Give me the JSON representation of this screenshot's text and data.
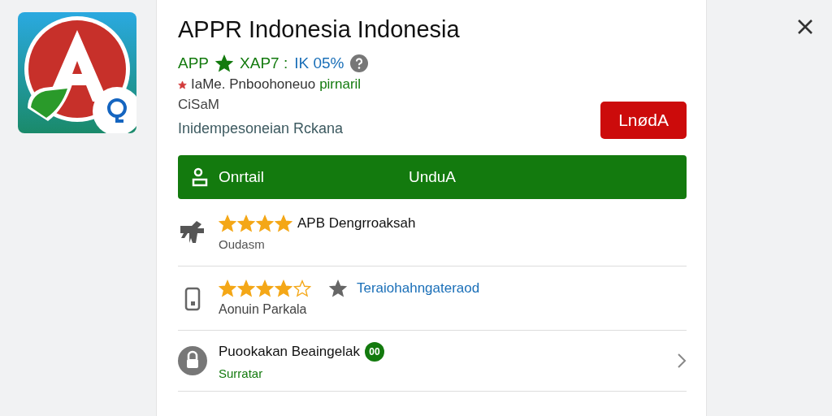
{
  "app": {
    "title": "APPR Indonesia Indonesia",
    "meta": {
      "label": "APP",
      "code": "XAP7 :",
      "percent": "IK 05%"
    },
    "developer": {
      "name": "IaMe. Pnboohoneuo",
      "tag": "pirnaril"
    },
    "size": "CiSaM",
    "category": "Inidempesoneian Rckana",
    "action_button": "LnødA"
  },
  "install_bar": {
    "label": "Onrtail",
    "action": "UnduA"
  },
  "rows": [
    {
      "kind": "rating",
      "stars": 4,
      "title": "APB Dengrroaksah",
      "subtitle": "Oudasm"
    },
    {
      "kind": "rating_link",
      "stars": 4,
      "title": "Teraiohahngateraod",
      "subtitle": "Aonuin Parkala"
    },
    {
      "kind": "nav",
      "title": "Puookakan Beaingelak",
      "badge": "00",
      "subtitle": "Surratar"
    }
  ]
}
